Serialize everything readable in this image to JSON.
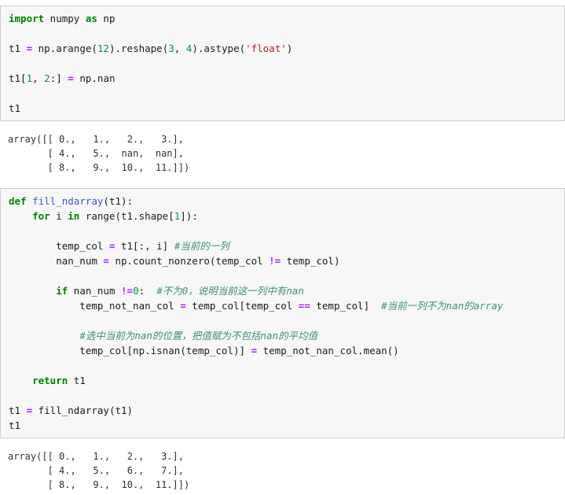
{
  "document": {
    "type": "jupyter-notebook-screenshot",
    "title": "numpy fill nan values notebook"
  },
  "cells": [
    {
      "name": "input-cell-1",
      "kind": "input",
      "lines": [
        [
          {
            "t": "import",
            "c": "kw"
          },
          {
            "t": " numpy ",
            "c": "pl"
          },
          {
            "t": "as",
            "c": "kw"
          },
          {
            "t": " np",
            "c": "pl"
          }
        ],
        [],
        [
          {
            "t": "t1 ",
            "c": "pl"
          },
          {
            "t": "=",
            "c": "op"
          },
          {
            "t": " np.arange(",
            "c": "pl"
          },
          {
            "t": "12",
            "c": "num"
          },
          {
            "t": ").reshape(",
            "c": "pl"
          },
          {
            "t": "3",
            "c": "num"
          },
          {
            "t": ", ",
            "c": "pl"
          },
          {
            "t": "4",
            "c": "num"
          },
          {
            "t": ").astype(",
            "c": "pl"
          },
          {
            "t": "'float'",
            "c": "str"
          },
          {
            "t": ")",
            "c": "pl"
          }
        ],
        [],
        [
          {
            "t": "t1[",
            "c": "pl"
          },
          {
            "t": "1",
            "c": "num"
          },
          {
            "t": ", ",
            "c": "pl"
          },
          {
            "t": "2",
            "c": "num"
          },
          {
            "t": ":] ",
            "c": "pl"
          },
          {
            "t": "=",
            "c": "op"
          },
          {
            "t": " np.nan",
            "c": "pl"
          }
        ],
        [],
        [
          {
            "t": "t1",
            "c": "pl"
          }
        ]
      ]
    },
    {
      "name": "output-cell-1",
      "kind": "output",
      "text": "array([[ 0.,   1.,   2.,   3.],\n       [ 4.,   5.,  nan,  nan],\n       [ 8.,   9.,  10.,  11.]])"
    },
    {
      "name": "input-cell-2",
      "kind": "input",
      "lines": [
        [
          {
            "t": "def",
            "c": "kw"
          },
          {
            "t": " ",
            "c": "pl"
          },
          {
            "t": "fill_ndarray",
            "c": "fn"
          },
          {
            "t": "(t1):",
            "c": "pl"
          }
        ],
        [
          {
            "t": "    ",
            "c": "pl"
          },
          {
            "t": "for",
            "c": "kw"
          },
          {
            "t": " i ",
            "c": "pl"
          },
          {
            "t": "in",
            "c": "kw"
          },
          {
            "t": " range(t1.shape[",
            "c": "pl"
          },
          {
            "t": "1",
            "c": "num"
          },
          {
            "t": "]):",
            "c": "pl"
          }
        ],
        [],
        [
          {
            "t": "        temp_col ",
            "c": "pl"
          },
          {
            "t": "=",
            "c": "op"
          },
          {
            "t": " t1[:, i] ",
            "c": "pl"
          },
          {
            "t": "#当前的一列",
            "c": "cm"
          }
        ],
        [
          {
            "t": "        nan_num ",
            "c": "pl"
          },
          {
            "t": "=",
            "c": "op"
          },
          {
            "t": " np.count_nonzero(temp_col ",
            "c": "pl"
          },
          {
            "t": "!=",
            "c": "op"
          },
          {
            "t": " temp_col)",
            "c": "pl"
          }
        ],
        [],
        [
          {
            "t": "        ",
            "c": "pl"
          },
          {
            "t": "if",
            "c": "kw"
          },
          {
            "t": " nan_num ",
            "c": "pl"
          },
          {
            "t": "!=",
            "c": "op"
          },
          {
            "t": "0",
            "c": "num"
          },
          {
            "t": ":  ",
            "c": "pl"
          },
          {
            "t": "#不为0，说明当前这一列中有nan",
            "c": "cm"
          }
        ],
        [
          {
            "t": "            temp_not_nan_col ",
            "c": "pl"
          },
          {
            "t": "=",
            "c": "op"
          },
          {
            "t": " temp_col[temp_col ",
            "c": "pl"
          },
          {
            "t": "==",
            "c": "op"
          },
          {
            "t": " temp_col]  ",
            "c": "pl"
          },
          {
            "t": "#当前一列不为nan的array",
            "c": "cm"
          }
        ],
        [],
        [
          {
            "t": "            ",
            "c": "pl"
          },
          {
            "t": "#选中当前为nan的位置，把值赋为不包括nan的平均值",
            "c": "cm"
          }
        ],
        [
          {
            "t": "            temp_col[np.isnan(temp_col)] ",
            "c": "pl"
          },
          {
            "t": "=",
            "c": "op"
          },
          {
            "t": " temp_not_nan_col.mean()",
            "c": "pl"
          }
        ],
        [],
        [
          {
            "t": "    ",
            "c": "pl"
          },
          {
            "t": "return",
            "c": "kw"
          },
          {
            "t": " t1",
            "c": "pl"
          }
        ],
        [],
        [
          {
            "t": "t1 ",
            "c": "pl"
          },
          {
            "t": "=",
            "c": "op"
          },
          {
            "t": " fill_ndarray(t1)",
            "c": "pl"
          }
        ],
        [
          {
            "t": "t1",
            "c": "pl"
          }
        ]
      ]
    },
    {
      "name": "output-cell-2",
      "kind": "output",
      "text": "array([[ 0.,   1.,   2.,   3.],\n       [ 4.,   5.,   6.,   7.],\n       [ 8.,   9.,  10.,  11.]])"
    }
  ],
  "colors": {
    "keyword": "#008000",
    "function": "#3e55cc",
    "number": "#0e8a4e",
    "string": "#ba2121",
    "operator": "#aa22ff",
    "comment": "#3c8f7c",
    "plain": "#1a1a1a",
    "input_background": "#f7f7f7",
    "input_border": "#cfcfcf",
    "output_background": "#ffffff"
  }
}
